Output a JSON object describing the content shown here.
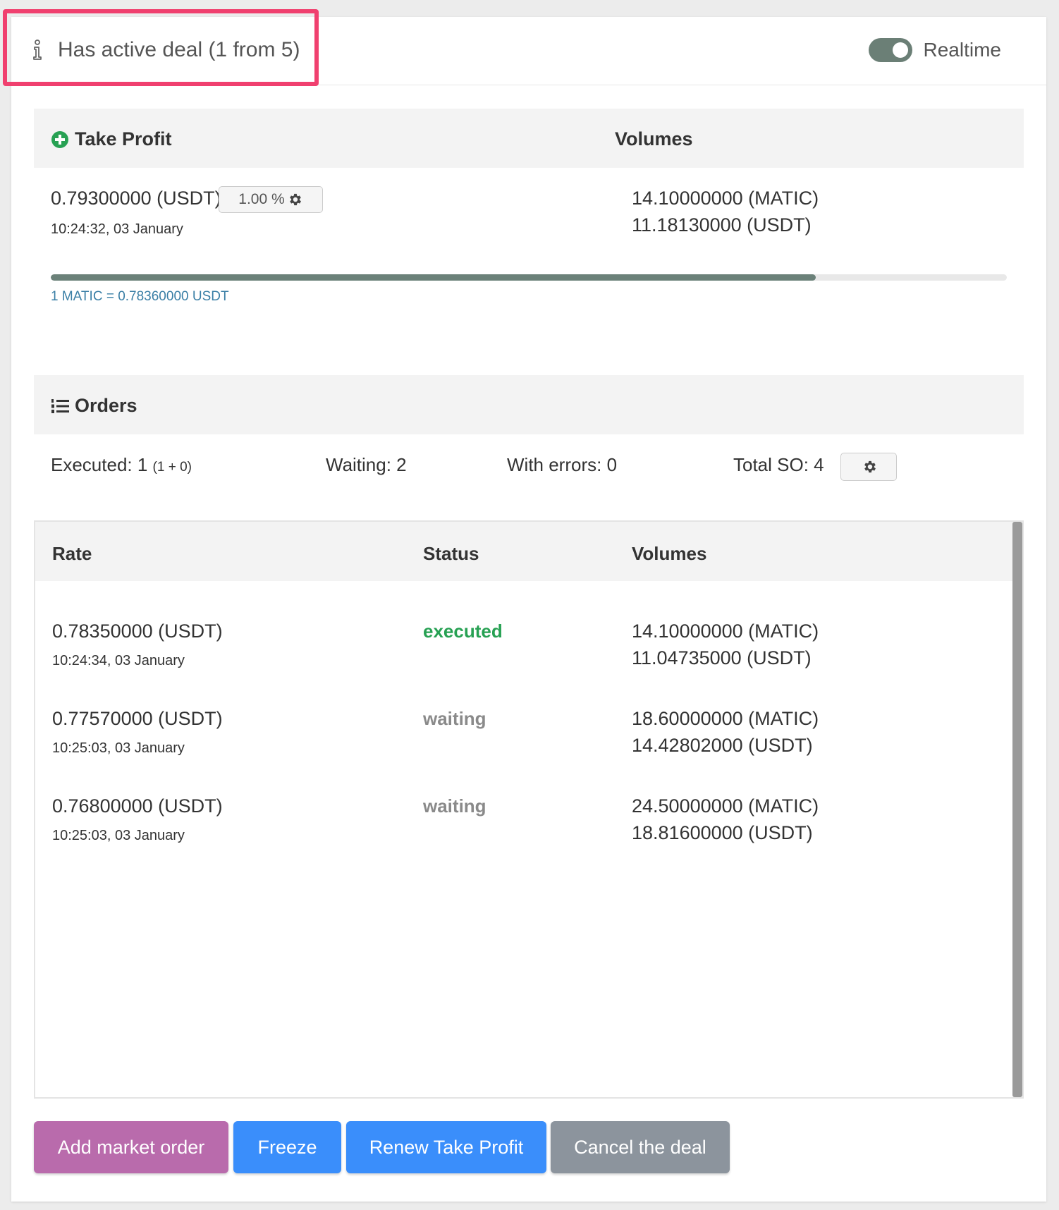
{
  "header": {
    "title": "Has active deal (1 from 5)",
    "toggle_label": "Realtime",
    "toggle_on": true
  },
  "take_profit": {
    "section_title": "Take Profit",
    "volumes_title": "Volumes",
    "value": "0.79300000 (USDT)",
    "time": "10:24:32, 03 January",
    "percent_label": "1.00 %",
    "volume_base": "14.10000000 (MATIC)",
    "volume_quote": "11.18130000 (USDT)",
    "progress_fraction": 0.8,
    "rate_line": "1 MATIC = 0.78360000 USDT"
  },
  "orders": {
    "section_title": "Orders",
    "executed_label": "Executed: 1",
    "executed_detail": "(1 + 0)",
    "waiting_label": "Waiting: 2",
    "errors_label": "With errors: 0",
    "total_so_label": "Total SO: 4",
    "columns": [
      "Rate",
      "Status",
      "Volumes"
    ],
    "rows": [
      {
        "rate": "0.78350000 (USDT)",
        "time": "10:24:34, 03 January",
        "status": "executed",
        "vol_base": "14.10000000 (MATIC)",
        "vol_quote": "11.04735000 (USDT)"
      },
      {
        "rate": "0.77570000 (USDT)",
        "time": "10:25:03, 03 January",
        "status": "waiting",
        "vol_base": "18.60000000 (MATIC)",
        "vol_quote": "14.42802000 (USDT)"
      },
      {
        "rate": "0.76800000 (USDT)",
        "time": "10:25:03, 03 January",
        "status": "waiting",
        "vol_base": "24.50000000 (MATIC)",
        "vol_quote": "18.81600000 (USDT)"
      }
    ]
  },
  "actions": {
    "add_market_order": "Add market order",
    "freeze": "Freeze",
    "renew_take_profit": "Renew Take Profit",
    "cancel_deal": "Cancel the deal"
  },
  "colors": {
    "highlight": "#f0406f",
    "toggle": "#6b7f76",
    "executed": "#27a153",
    "waiting": "#8a8a8a",
    "add_market_order_bg": "#b96bac",
    "freeze_bg": "#3a8efb",
    "renew_bg": "#3a8efb",
    "cancel_bg": "#8c949d",
    "rate_text": "#3a7fa6"
  }
}
